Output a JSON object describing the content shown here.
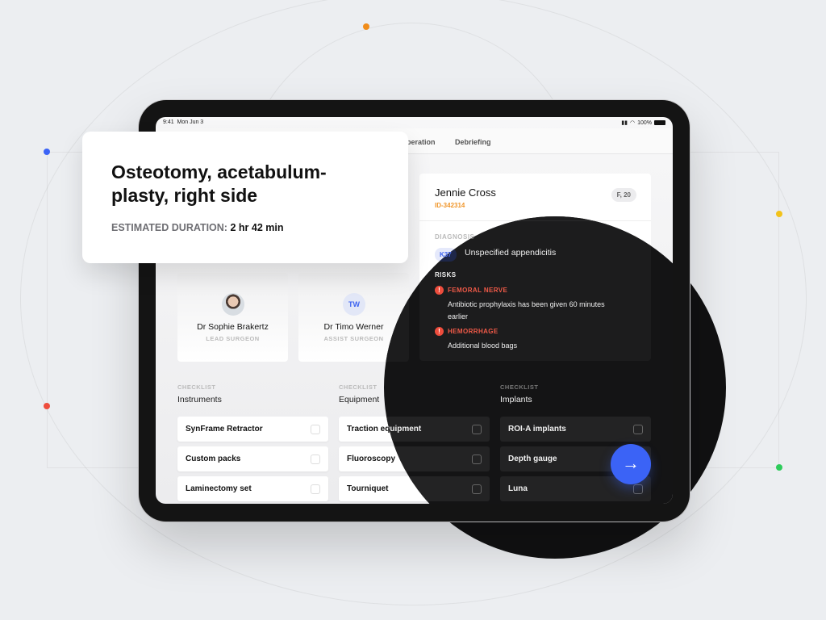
{
  "statusbar": {
    "time": "9:41",
    "date": "Mon Jun 3",
    "battery": "100%"
  },
  "tabs": [
    {
      "label": "Operation"
    },
    {
      "label": "Debriefing"
    }
  ],
  "procedure": {
    "title": "Osteotomy, acetabulum-plasty, right side",
    "duration_label": "ESTIMATED DURATION:",
    "duration_value": "2 hr 42 min"
  },
  "patient": {
    "name": "Jennie Cross",
    "id": "ID-342314",
    "badge": "F, 20",
    "diagnosis_label": "DIAGNOSIS",
    "diagnosis_code": "K37",
    "diagnosis_text": "Unspecified appendicitis",
    "risks_label": "RISKS",
    "risks": [
      {
        "title": "FEMORAL NERVE",
        "description": "Antibiotic prophylaxis has been given 60 minutes earlier"
      },
      {
        "title": "HEMORRHAGE",
        "description": "Additional blood bags"
      }
    ]
  },
  "surgeons": [
    {
      "name": "Dr Sophie Brakertz",
      "role": "LEAD SURGEON",
      "initials": ""
    },
    {
      "name": "Dr Timo Werner",
      "role": "ASSIST SURGEON",
      "initials": "TW"
    }
  ],
  "checklists": [
    {
      "label": "CHECKLIST",
      "title": "Instruments",
      "items": [
        "SynFrame Retractor",
        "Custom packs",
        "Laminectomy set"
      ]
    },
    {
      "label": "CHECKLIST",
      "title": "Equipment",
      "items": [
        "Traction equipment",
        "Fluoroscopy",
        "Tourniquet"
      ]
    },
    {
      "label": "CHECKLIST",
      "title": "Implants",
      "items": [
        "ROI-A implants",
        "Depth gauge",
        "Luna"
      ]
    }
  ],
  "fab": {
    "icon": "arrow-right-icon",
    "glyph": "→"
  },
  "colors": {
    "accent": "#3b63f6",
    "patient_id": "#f0962a",
    "risk": "#f05a48",
    "dots": [
      "#f08c1a",
      "#3b63f6",
      "#f2c21a",
      "#ee4d3d",
      "#2ecc5b"
    ]
  }
}
